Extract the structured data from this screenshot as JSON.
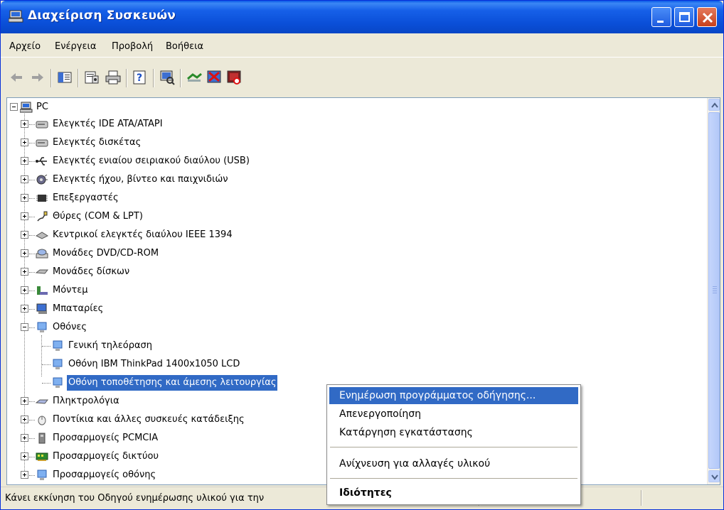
{
  "window": {
    "title": "Διαχείριση Συσκευών"
  },
  "menu": [
    "Αρχείο",
    "Ενέργεια",
    "Προβολή",
    "Βοήθεια"
  ],
  "toolbar": {
    "icons": [
      "back-icon",
      "forward-icon",
      "show-hide-console-tree-icon",
      "properties-icon",
      "print-icon",
      "help-icon",
      "scan-hardware-icon",
      "update-driver-icon",
      "uninstall-icon",
      "disable-icon"
    ]
  },
  "tree": {
    "root": "PC",
    "categories": [
      {
        "label": "Ελεγκτές IDE ATA/ATAPI",
        "icon": "ide-controller-icon"
      },
      {
        "label": "Ελεγκτές δισκέτας",
        "icon": "floppy-controller-icon"
      },
      {
        "label": "Ελεγκτές ενιαίου σειριακού διαύλου (USB)",
        "icon": "usb-icon"
      },
      {
        "label": "Ελεγκτές ήχου, βίντεο και παιχνιδιών",
        "icon": "sound-icon"
      },
      {
        "label": "Επεξεργαστές",
        "icon": "processor-icon"
      },
      {
        "label": "Θύρες (COM & LPT)",
        "icon": "port-icon"
      },
      {
        "label": "Κεντρικοί ελεγκτές διαύλου IEEE 1394",
        "icon": "ieee1394-icon"
      },
      {
        "label": "Μονάδες DVD/CD-ROM",
        "icon": "cdrom-icon"
      },
      {
        "label": "Μονάδες δίσκων",
        "icon": "disk-drive-icon"
      },
      {
        "label": "Μόντεμ",
        "icon": "modem-icon"
      },
      {
        "label": "Μπαταρίες",
        "icon": "battery-icon"
      },
      {
        "label": "Οθόνες",
        "icon": "monitor-icon",
        "expanded": true,
        "children": [
          {
            "label": "Γενική τηλεόραση"
          },
          {
            "label": "Οθόνη IBM ThinkPad 1400x1050 LCD"
          },
          {
            "label": "Οθόνη τοποθέτησης και άμεσης λειτουργίας",
            "selected": true
          }
        ]
      },
      {
        "label": "Πληκτρολόγια",
        "icon": "keyboard-icon"
      },
      {
        "label": "Ποντίκια και άλλες συσκευές κατάδειξης",
        "icon": "mouse-icon"
      },
      {
        "label": "Προσαρμογείς PCMCIA",
        "icon": "pcmcia-icon"
      },
      {
        "label": "Προσαρμογείς δικτύου",
        "icon": "network-adapter-icon"
      },
      {
        "label": "Προσαρμογείς οθόνης",
        "icon": "display-adapter-icon"
      }
    ]
  },
  "status": {
    "text": "Κάνει εκκίνηση του Οδηγού ενημέρωσης υλικού για την"
  },
  "context_menu": {
    "items": [
      {
        "label": "Ενημέρωση προγράμματος οδήγησης...",
        "highlighted": true
      },
      {
        "label": "Απενεργοποίηση"
      },
      {
        "label": "Κατάργηση εγκατάστασης"
      },
      {
        "label": "Ανίχνευση για αλλαγές υλικού"
      },
      {
        "label": "Ιδιότητες",
        "bold": true
      }
    ]
  },
  "colors": {
    "title_blue": "#0a4fd8",
    "selection": "#316ac5"
  }
}
